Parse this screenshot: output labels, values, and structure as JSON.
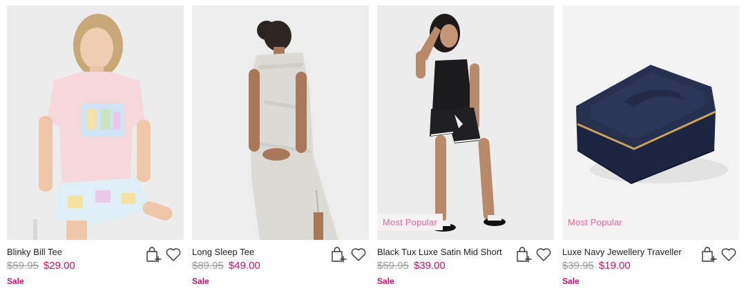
{
  "products": [
    {
      "name": "Blinky Bill Tee",
      "was_price": "$59.95",
      "now_price": "$29.00",
      "sale_label": "Sale",
      "badge": ""
    },
    {
      "name": "Long Sleep Tee",
      "was_price": "$89.95",
      "now_price": "$49.00",
      "sale_label": "Sale",
      "badge": ""
    },
    {
      "name": "Black Tux Luxe Satin Mid Short",
      "was_price": "$59.95",
      "now_price": "$39.00",
      "sale_label": "Sale",
      "badge": "Most Popular"
    },
    {
      "name": "Luxe Navy Jewellery Traveller",
      "was_price": "$39.95",
      "now_price": "$19.00",
      "sale_label": "Sale",
      "badge": "Most Popular"
    }
  ],
  "icons": {
    "add_to_bag": "bag-plus-icon",
    "wishlist": "heart-icon"
  },
  "colors": {
    "sale_price": "#c8106e",
    "was_price": "#9a9a9a",
    "badge_text": "#e0689a",
    "badge_bg": "#f6f1f2"
  }
}
